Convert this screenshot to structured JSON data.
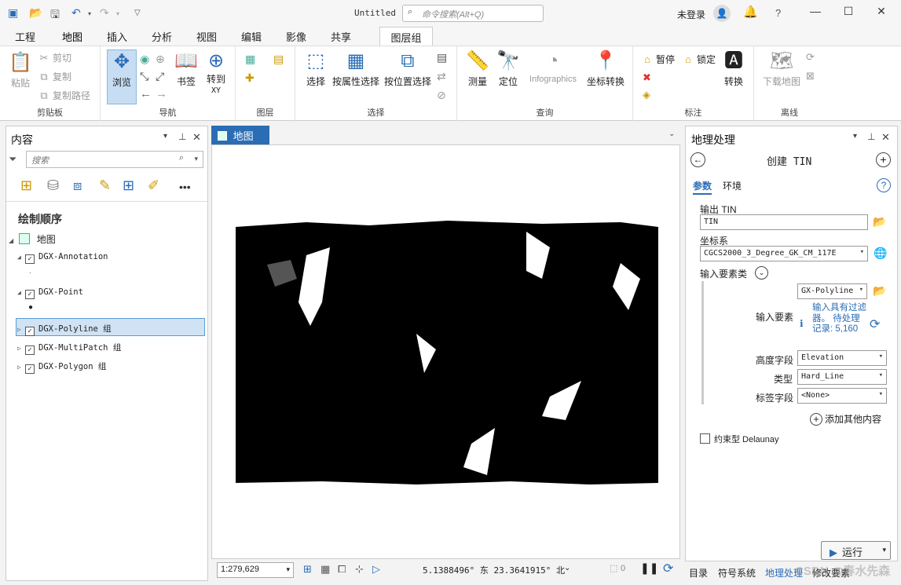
{
  "titlebar": {
    "doc_title": "Untitled",
    "search_placeholder": "命令搜索(Alt+Q)",
    "user": "未登录",
    "help": "?"
  },
  "ribbon_tabs": [
    "工程",
    "地图",
    "插入",
    "分析",
    "视图",
    "编辑",
    "影像",
    "共享"
  ],
  "contextual_tab": "图层组",
  "ribbon": {
    "clipboard": {
      "paste": "粘贴",
      "cut": "剪切",
      "copy": "复制",
      "copy_path": "复制路径",
      "label": "剪贴板"
    },
    "navigate": {
      "explore": "浏览",
      "bookmarks": "书签",
      "goto_xy_1": "转到",
      "goto_xy_2": "XY",
      "label": "导航"
    },
    "layer": {
      "label": "图层"
    },
    "selection": {
      "select": "选择",
      "by_attr": "按属性选择",
      "by_loc": "按位置选择",
      "label": "选择"
    },
    "inquiry": {
      "measure": "测量",
      "locate": "定位",
      "infographics": "Infographics",
      "coord_convert": "坐标转换",
      "label": "查询"
    },
    "labeling": {
      "pause": "暂停",
      "lock": "锁定",
      "convert": "转换",
      "label": "标注"
    },
    "offline": {
      "download": "下载地图",
      "label": "离线"
    }
  },
  "contents": {
    "title": "内容",
    "search_placeholder": "搜索",
    "section": "绘制顺序",
    "map_name": "地图",
    "layers": [
      "DGX-Annotation",
      "DGX-Point",
      "DGX-Polyline 组",
      "DGX-MultiPatch 组",
      "DGX-Polygon 组"
    ]
  },
  "map_view": {
    "tab": "地图",
    "scale": "1:279,629",
    "coordinates": "5.1388496° 东  23.3641915° 北",
    "selected_count": "0"
  },
  "geoprocessing": {
    "title": "地理处理",
    "tool_name": "创建 TIN",
    "tabs": [
      "参数",
      "环境"
    ],
    "output_label": "输出 TIN",
    "output_value": "TIN",
    "crs_label": "坐标系",
    "crs_value": "CGCS2000_3_Degree_GK_CM_117E",
    "input_fc_label": "输入要素类",
    "input_layer": "GX-Polyline",
    "input_features_label": "输入要素",
    "input_features_msg": "输入具有过滤器。 待处理记录: 5,160",
    "height_field_label": "高度字段",
    "height_field": "Elevation",
    "type_label": "类型",
    "type_value": "Hard_Line",
    "tag_field_label": "标签字段",
    "tag_field": "<None>",
    "add_more": "添加其他内容",
    "delaunay": "约束型 Delaunay",
    "run": "运行"
  },
  "bottom_tabs": [
    "目录",
    "符号系统",
    "地理处理",
    "修改要素"
  ],
  "watermark": "CSDN @春水先森"
}
